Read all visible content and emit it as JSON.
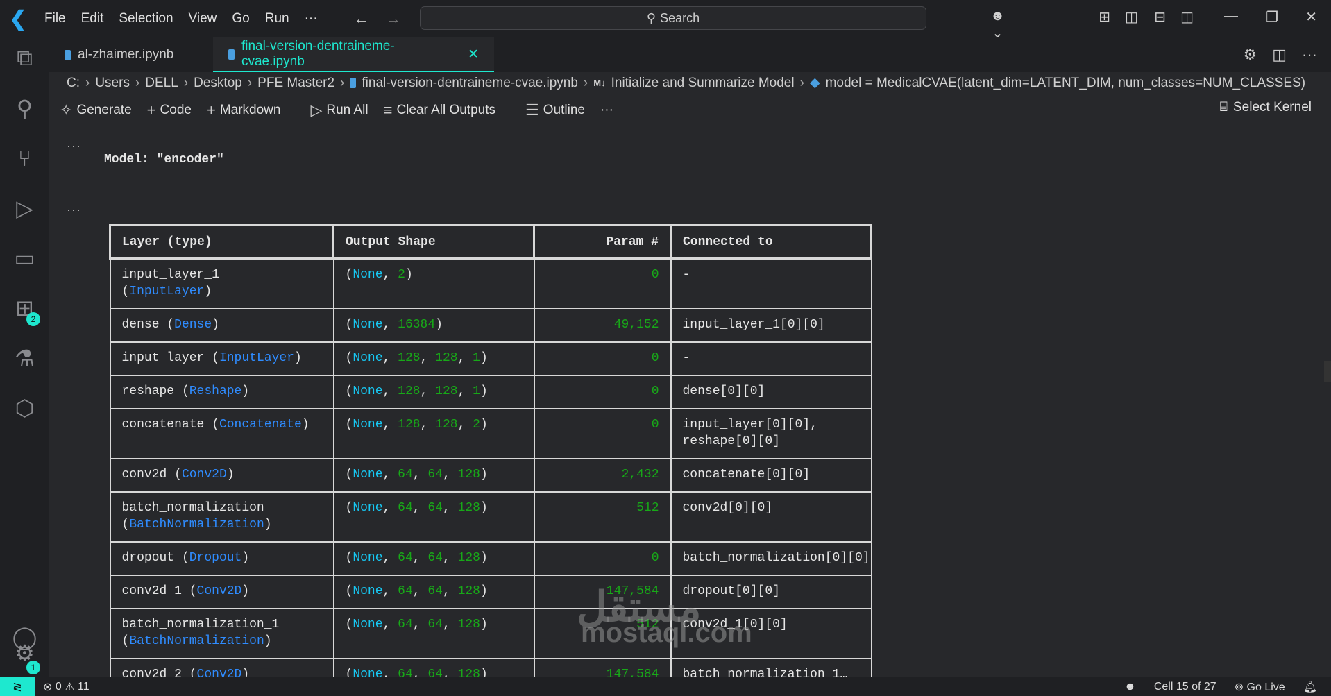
{
  "titlebar": {
    "menu": [
      "File",
      "Edit",
      "Selection",
      "View",
      "Go",
      "Run",
      "···"
    ],
    "search_placeholder": "Search"
  },
  "tabs": [
    {
      "label": "al-zhaimer.ipynb",
      "active": false
    },
    {
      "label": "final-version-dentraineme-cvae.ipynb",
      "active": true
    }
  ],
  "breadcrumb": [
    "C:",
    "Users",
    "DELL",
    "Desktop",
    "PFE Master2",
    "final-version-dentraineme-cvae.ipynb",
    "Initialize and Summarize Model",
    "model = MedicalCVAE(latent_dim=LATENT_DIM, num_classes=NUM_CLASSES)"
  ],
  "toolbar": {
    "generate": "Generate",
    "code": "Code",
    "markdown": "Markdown",
    "run_all": "Run All",
    "clear": "Clear All Outputs",
    "outline": "Outline",
    "more": "···",
    "kernel": "Select Kernel"
  },
  "output": {
    "dots": "···",
    "model_title": "Model: \"encoder\"",
    "headers": [
      "Layer (type)",
      "Output Shape",
      "Param #",
      "Connected to"
    ],
    "rows": [
      {
        "name": "input_layer_1",
        "type": "InputLayer",
        "wrap": true,
        "shape": [
          "None",
          "2"
        ],
        "params": "0",
        "connected": [
          "-"
        ]
      },
      {
        "name": "dense",
        "type": "Dense",
        "shape": [
          "None",
          "16384"
        ],
        "params": "49,152",
        "connected": [
          "input_layer_1[0][0]"
        ]
      },
      {
        "name": "input_layer",
        "type": "InputLayer",
        "shape": [
          "None",
          "128",
          "128",
          "1"
        ],
        "params": "0",
        "connected": [
          "-"
        ]
      },
      {
        "name": "reshape",
        "type": "Reshape",
        "shape": [
          "None",
          "128",
          "128",
          "1"
        ],
        "params": "0",
        "connected": [
          "dense[0][0]"
        ]
      },
      {
        "name": "concatenate",
        "type": "Concatenate",
        "shape": [
          "None",
          "128",
          "128",
          "2"
        ],
        "params": "0",
        "connected": [
          "input_layer[0][0],",
          "reshape[0][0]"
        ]
      },
      {
        "name": "conv2d",
        "type": "Conv2D",
        "shape": [
          "None",
          "64",
          "64",
          "128"
        ],
        "params": "2,432",
        "connected": [
          "concatenate[0][0]"
        ]
      },
      {
        "name": "batch_normalization",
        "type": "BatchNormalization",
        "wrap": true,
        "shape": [
          "None",
          "64",
          "64",
          "128"
        ],
        "params": "512",
        "connected": [
          "conv2d[0][0]"
        ]
      },
      {
        "name": "dropout",
        "type": "Dropout",
        "shape": [
          "None",
          "64",
          "64",
          "128"
        ],
        "params": "0",
        "connected": [
          "batch_normalization[0][0]"
        ]
      },
      {
        "name": "conv2d_1",
        "type": "Conv2D",
        "shape": [
          "None",
          "64",
          "64",
          "128"
        ],
        "params": "147,584",
        "connected": [
          "dropout[0][0]"
        ]
      },
      {
        "name": "batch_normalization_1",
        "type": "BatchNormalization",
        "wrap": true,
        "shape": [
          "None",
          "64",
          "64",
          "128"
        ],
        "params": "512",
        "connected": [
          "conv2d_1[0][0]"
        ]
      },
      {
        "name": "conv2d_2",
        "type": "Conv2D",
        "shape": [
          "None",
          "64",
          "64",
          "128"
        ],
        "params": "147,584",
        "connected": [
          "batch_normalization_1…"
        ]
      }
    ]
  },
  "watermark": {
    "arabic": "مستقل",
    "latin": "mostaql.com"
  },
  "status": {
    "errors": "0",
    "warnings": "11",
    "cell": "Cell 15 of 27",
    "golive": "Go Live",
    "activity_badges": [
      "2",
      "1"
    ]
  },
  "colors": {
    "accent": "#1ee8cf",
    "type": "#2f8cff",
    "none": "#17c7f2",
    "number": "#18a818"
  }
}
